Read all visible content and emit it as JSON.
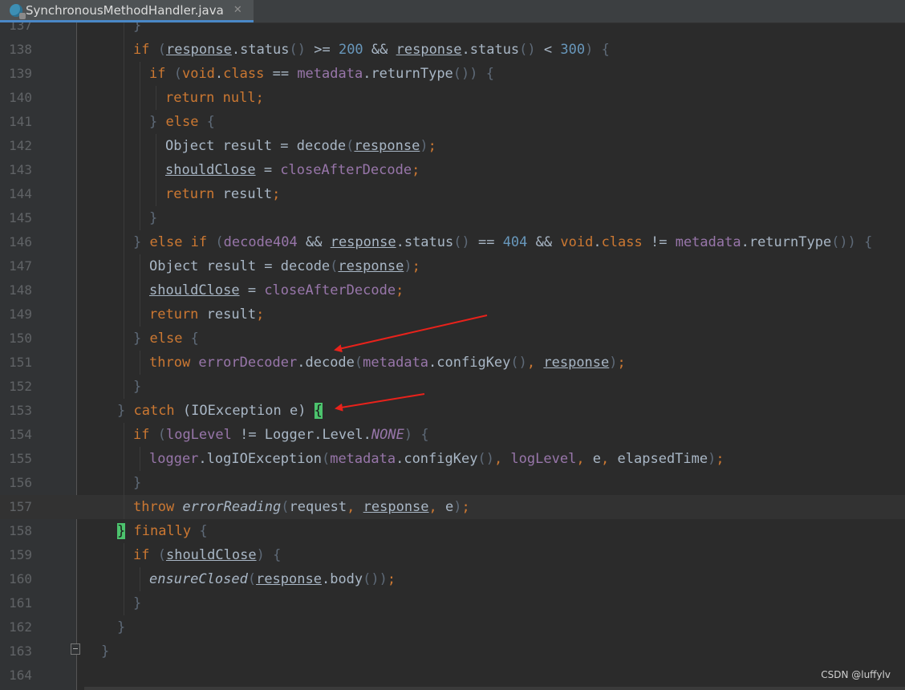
{
  "tab": {
    "title": "SynchronousMethodHandler.java",
    "close": "✕",
    "icon": "java-class-icon"
  },
  "watermark": "CSDN @luffylv",
  "colors": {
    "keyword": "#cc7832",
    "number": "#6897bb",
    "field": "#9876aa",
    "text": "#a9b7c6",
    "arrow": "#e8221b"
  },
  "lines": [
    {
      "n": "137",
      "indent": 4,
      "tokens": [
        [
          "p",
          "}"
        ]
      ]
    },
    {
      "n": "138",
      "indent": 4,
      "tokens": [
        [
          "k",
          "if "
        ],
        [
          "p",
          "("
        ],
        [
          "u",
          "response"
        ],
        [
          "t",
          ".status"
        ],
        [
          "p",
          "()"
        ],
        [
          "t",
          " >= "
        ],
        [
          "n",
          "200"
        ],
        [
          "t",
          " && "
        ],
        [
          "u",
          "response"
        ],
        [
          "t",
          ".status"
        ],
        [
          "p",
          "()"
        ],
        [
          "t",
          " < "
        ],
        [
          "n",
          "300"
        ],
        [
          "p",
          ")"
        ],
        [
          "t",
          " "
        ],
        [
          "p",
          "{"
        ]
      ]
    },
    {
      "n": "139",
      "indent": 5,
      "tokens": [
        [
          "k",
          "if "
        ],
        [
          "p",
          "("
        ],
        [
          "k",
          "void"
        ],
        [
          "t",
          "."
        ],
        [
          "k",
          "class"
        ],
        [
          "t",
          " == "
        ],
        [
          "f",
          "metadata"
        ],
        [
          "t",
          ".returnType"
        ],
        [
          "p",
          "())"
        ],
        [
          "t",
          " "
        ],
        [
          "p",
          "{"
        ]
      ]
    },
    {
      "n": "140",
      "indent": 6,
      "tokens": [
        [
          "k",
          "return null"
        ],
        [
          "k",
          ";"
        ]
      ]
    },
    {
      "n": "141",
      "indent": 5,
      "tokens": [
        [
          "p",
          "}"
        ],
        [
          "k",
          " else "
        ],
        [
          "p",
          "{"
        ]
      ]
    },
    {
      "n": "142",
      "indent": 6,
      "tokens": [
        [
          "t",
          "Object result = decode"
        ],
        [
          "p",
          "("
        ],
        [
          "u",
          "response"
        ],
        [
          "p",
          ")"
        ],
        [
          "k",
          ";"
        ]
      ]
    },
    {
      "n": "143",
      "indent": 6,
      "tokens": [
        [
          "u",
          "shouldClose"
        ],
        [
          "t",
          " = "
        ],
        [
          "f",
          "closeAfterDecode"
        ],
        [
          "k",
          ";"
        ]
      ]
    },
    {
      "n": "144",
      "indent": 6,
      "tokens": [
        [
          "k",
          "return "
        ],
        [
          "t",
          "result"
        ],
        [
          "k",
          ";"
        ]
      ]
    },
    {
      "n": "145",
      "indent": 5,
      "tokens": [
        [
          "p",
          "}"
        ]
      ]
    },
    {
      "n": "146",
      "indent": 4,
      "tokens": [
        [
          "p",
          "}"
        ],
        [
          "k",
          " else if "
        ],
        [
          "p",
          "("
        ],
        [
          "f",
          "decode404"
        ],
        [
          "t",
          " && "
        ],
        [
          "u",
          "response"
        ],
        [
          "t",
          ".status"
        ],
        [
          "p",
          "()"
        ],
        [
          "t",
          " == "
        ],
        [
          "n",
          "404"
        ],
        [
          "t",
          " && "
        ],
        [
          "k",
          "void"
        ],
        [
          "t",
          "."
        ],
        [
          "k",
          "class"
        ],
        [
          "t",
          " != "
        ],
        [
          "f",
          "metadata"
        ],
        [
          "t",
          ".returnType"
        ],
        [
          "p",
          "())"
        ],
        [
          "t",
          " "
        ],
        [
          "p",
          "{"
        ]
      ]
    },
    {
      "n": "147",
      "indent": 5,
      "tokens": [
        [
          "t",
          "Object result = decode"
        ],
        [
          "p",
          "("
        ],
        [
          "u",
          "response"
        ],
        [
          "p",
          ")"
        ],
        [
          "k",
          ";"
        ]
      ]
    },
    {
      "n": "148",
      "indent": 5,
      "tokens": [
        [
          "u",
          "shouldClose"
        ],
        [
          "t",
          " = "
        ],
        [
          "f",
          "closeAfterDecode"
        ],
        [
          "k",
          ";"
        ]
      ]
    },
    {
      "n": "149",
      "indent": 5,
      "tokens": [
        [
          "k",
          "return "
        ],
        [
          "t",
          "result"
        ],
        [
          "k",
          ";"
        ]
      ]
    },
    {
      "n": "150",
      "indent": 4,
      "tokens": [
        [
          "p",
          "}"
        ],
        [
          "k",
          " else "
        ],
        [
          "p",
          "{"
        ]
      ]
    },
    {
      "n": "151",
      "indent": 5,
      "tokens": [
        [
          "k",
          "throw "
        ],
        [
          "f",
          "errorDecoder"
        ],
        [
          "t",
          ".decode"
        ],
        [
          "p",
          "("
        ],
        [
          "f",
          "metadata"
        ],
        [
          "t",
          ".configKey"
        ],
        [
          "p",
          "()"
        ],
        [
          "k",
          ", "
        ],
        [
          "u",
          "response"
        ],
        [
          "p",
          ")"
        ],
        [
          "k",
          ";"
        ]
      ]
    },
    {
      "n": "152",
      "indent": 4,
      "tokens": [
        [
          "p",
          "}"
        ]
      ]
    },
    {
      "n": "153",
      "indent": 3,
      "tokens": [
        [
          "p",
          "}"
        ],
        [
          "k",
          " catch "
        ],
        [
          "t",
          "(IOException e) "
        ],
        [
          "h",
          "{"
        ]
      ]
    },
    {
      "n": "154",
      "indent": 4,
      "tokens": [
        [
          "k",
          "if "
        ],
        [
          "p",
          "("
        ],
        [
          "f",
          "logLevel"
        ],
        [
          "t",
          " != Logger.Level."
        ],
        [
          "fi",
          "NONE"
        ],
        [
          "p",
          ")"
        ],
        [
          "t",
          " "
        ],
        [
          "p",
          "{"
        ]
      ]
    },
    {
      "n": "155",
      "indent": 5,
      "tokens": [
        [
          "f",
          "logger"
        ],
        [
          "t",
          ".logIOException"
        ],
        [
          "p",
          "("
        ],
        [
          "f",
          "metadata"
        ],
        [
          "t",
          ".configKey"
        ],
        [
          "p",
          "()"
        ],
        [
          "k",
          ", "
        ],
        [
          "f",
          "logLevel"
        ],
        [
          "k",
          ", "
        ],
        [
          "t",
          "e"
        ],
        [
          "k",
          ", "
        ],
        [
          "t",
          "elapsedTime"
        ],
        [
          "p",
          ")"
        ],
        [
          "k",
          ";"
        ]
      ]
    },
    {
      "n": "156",
      "indent": 4,
      "tokens": [
        [
          "p",
          "}"
        ]
      ]
    },
    {
      "n": "157",
      "indent": 4,
      "current": true,
      "tokens": [
        [
          "k",
          "throw "
        ],
        [
          "i",
          "errorReading"
        ],
        [
          "p",
          "("
        ],
        [
          "t",
          "request"
        ],
        [
          "k",
          ", "
        ],
        [
          "u",
          "response"
        ],
        [
          "k",
          ", "
        ],
        [
          "t",
          "e"
        ],
        [
          "p",
          ")"
        ],
        [
          "k",
          ";"
        ]
      ]
    },
    {
      "n": "158",
      "indent": 3,
      "tokens": [
        [
          "h",
          "}"
        ],
        [
          "k",
          " finally "
        ],
        [
          "p",
          "{"
        ]
      ]
    },
    {
      "n": "159",
      "indent": 4,
      "tokens": [
        [
          "k",
          "if "
        ],
        [
          "p",
          "("
        ],
        [
          "u",
          "shouldClose"
        ],
        [
          "p",
          ")"
        ],
        [
          "t",
          " "
        ],
        [
          "p",
          "{"
        ]
      ]
    },
    {
      "n": "160",
      "indent": 5,
      "tokens": [
        [
          "i",
          "ensureClosed"
        ],
        [
          "p",
          "("
        ],
        [
          "u",
          "response"
        ],
        [
          "t",
          ".body"
        ],
        [
          "p",
          "())"
        ],
        [
          "k",
          ";"
        ]
      ]
    },
    {
      "n": "161",
      "indent": 4,
      "tokens": [
        [
          "p",
          "}"
        ]
      ]
    },
    {
      "n": "162",
      "indent": 3,
      "tokens": [
        [
          "p",
          "}"
        ]
      ]
    },
    {
      "n": "163",
      "indent": 2,
      "tokens": [
        [
          "p",
          "}"
        ]
      ]
    },
    {
      "n": "164",
      "indent": 0,
      "tokens": []
    }
  ]
}
